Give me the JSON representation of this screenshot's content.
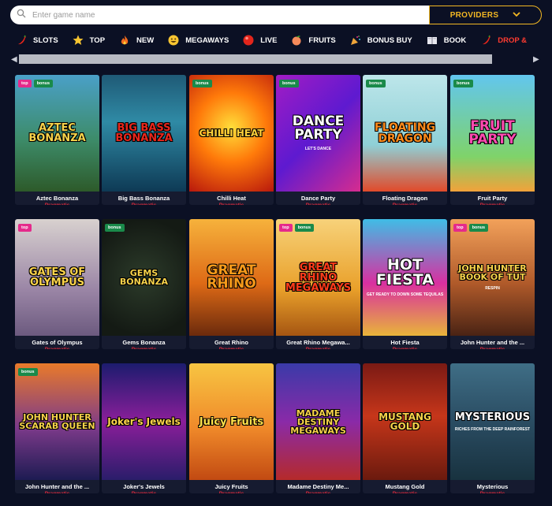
{
  "search": {
    "placeholder": "Enter game name"
  },
  "providers_button": {
    "label": "PROVIDERS"
  },
  "categories": [
    {
      "label": "SLOTS",
      "icon": "chili-pepper-icon"
    },
    {
      "label": "TOP",
      "icon": "star-icon"
    },
    {
      "label": "NEW",
      "icon": "fire-icon"
    },
    {
      "label": "MEGAWAYS",
      "icon": "grinning-face-icon"
    },
    {
      "label": "LIVE",
      "icon": "red-ball-icon"
    },
    {
      "label": "FRUITS",
      "icon": "peach-icon"
    },
    {
      "label": "BONUS BUY",
      "icon": "party-popper-icon"
    },
    {
      "label": "BOOK",
      "icon": "book-icon"
    },
    {
      "label": "DROP &",
      "icon": "chili-pepper-icon"
    }
  ],
  "colors": {
    "accent": "#f3b823",
    "provider_text": "#e0293c",
    "background": "#0b1024",
    "badge_top": "#e52a8b",
    "badge_bonus": "#1a8a4a"
  },
  "games": [
    {
      "name": "Aztec Bonanza",
      "provider": "Pragmatic",
      "badges": [
        "top",
        "bonus"
      ],
      "logo": "AZTEC BONANZA"
    },
    {
      "name": "Big Bass Bonanza",
      "provider": "Pragmatic",
      "badges": [],
      "logo": "BIG BASS BONANZA"
    },
    {
      "name": "Chilli Heat",
      "provider": "Pragmatic",
      "badges": [
        "bonus"
      ],
      "logo": "CHILLI HEAT"
    },
    {
      "name": "Dance Party",
      "provider": "Pragmatic",
      "badges": [
        "bonus"
      ],
      "logo": "DANCE PARTY",
      "sub": "LET'S DANCE"
    },
    {
      "name": "Floating Dragon",
      "provider": "Pragmatic",
      "badges": [
        "bonus"
      ],
      "logo": "FLOATING DRAGON"
    },
    {
      "name": "Fruit Party",
      "provider": "Pragmatic",
      "badges": [
        "bonus"
      ],
      "logo": "FRUIT PARTY"
    },
    {
      "name": "Gates of Olympus",
      "provider": "Pragmatic",
      "badges": [
        "top"
      ],
      "logo": "GATES OF OLYMPUS"
    },
    {
      "name": "Gems Bonanza",
      "provider": "Pragmatic",
      "badges": [
        "bonus"
      ],
      "logo": "GEMS BONANZA"
    },
    {
      "name": "Great Rhino",
      "provider": "Pragmatic",
      "badges": [],
      "logo": "GREAT RHINO"
    },
    {
      "name": "Great Rhino Megawa...",
      "provider": "Pragmatic",
      "badges": [
        "top",
        "bonus"
      ],
      "logo": "GREAT RHINO MEGAWAYS"
    },
    {
      "name": "Hot Fiesta",
      "provider": "Pragmatic",
      "badges": [],
      "logo": "HOT FIESTA",
      "sub": "GET READY TO DOWN SOME TEQUILAS"
    },
    {
      "name": "John Hunter and the ...",
      "provider": "Pragmatic",
      "badges": [
        "top",
        "bonus"
      ],
      "logo": "JOHN HUNTER BOOK OF TUT",
      "sub": "RESPIN"
    },
    {
      "name": "John Hunter and the ...",
      "provider": "Pragmatic",
      "badges": [
        "bonus"
      ],
      "logo": "JOHN HUNTER SCARAB QUEEN"
    },
    {
      "name": "Joker's Jewels",
      "provider": "Pragmatic",
      "badges": [],
      "logo": "Joker's Jewels"
    },
    {
      "name": "Juicy Fruits",
      "provider": "Pragmatic",
      "badges": [],
      "logo": "Juicy Fruits"
    },
    {
      "name": "Madame Destiny Me...",
      "provider": "Pragmatic",
      "badges": [],
      "logo": "MADAME DESTINY MEGAWAYS"
    },
    {
      "name": "Mustang Gold",
      "provider": "Pragmatic",
      "badges": [],
      "logo": "MUSTANG GOLD"
    },
    {
      "name": "Mysterious",
      "provider": "Pragmatic",
      "badges": [],
      "logo": "MYSTERIOUS",
      "sub": "RICHES FROM THE DEEP RAINFOREST"
    }
  ]
}
